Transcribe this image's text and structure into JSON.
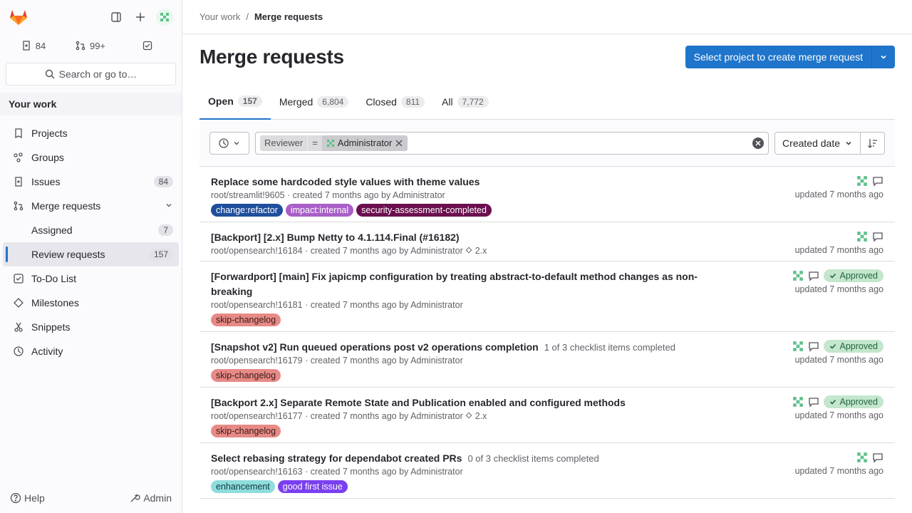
{
  "sidebar": {
    "counts": {
      "issues": "84",
      "merge_requests": "99+"
    },
    "search_label": "Search or go to…",
    "section_title": "Your work",
    "items": [
      {
        "label": "Projects"
      },
      {
        "label": "Groups"
      },
      {
        "label": "Issues",
        "badge": "84"
      },
      {
        "label": "Merge requests"
      },
      {
        "label": "Assigned",
        "badge": "7"
      },
      {
        "label": "Review requests",
        "badge": "157"
      },
      {
        "label": "To-Do List"
      },
      {
        "label": "Milestones"
      },
      {
        "label": "Snippets"
      },
      {
        "label": "Activity"
      }
    ],
    "help_label": "Help",
    "admin_label": "Admin"
  },
  "breadcrumb": {
    "parent": "Your work",
    "current": "Merge requests"
  },
  "page": {
    "title": "Merge requests",
    "cta_label": "Select project to create merge request"
  },
  "tabs": [
    {
      "label": "Open",
      "count": "157"
    },
    {
      "label": "Merged",
      "count": "6,804"
    },
    {
      "label": "Closed",
      "count": "811"
    },
    {
      "label": "All",
      "count": "7,772"
    }
  ],
  "filter": {
    "token_field": "Reviewer",
    "token_op": "=",
    "token_value": "Administrator",
    "sort_label": "Created date"
  },
  "merge_requests": [
    {
      "title": "Replace some hardcoded style values with theme values",
      "meta_ref": "root/streamlit!9605",
      "meta_created": "· created 7 months ago by",
      "author": "Administrator",
      "updated": "updated 7 months ago",
      "labels": [
        {
          "text": "change:refactor",
          "color": "#1f4e9c"
        },
        {
          "text": "impact:internal",
          "color": "#a95fc7"
        },
        {
          "text": "security-assessment-completed",
          "color": "#6b0f4e"
        }
      ]
    },
    {
      "title": "[Backport] [2.x] Bump Netty to 4.1.114.Final (#16182)",
      "meta_ref": "root/opensearch!16184",
      "meta_created": "· created 7 months ago by",
      "author": "Administrator",
      "milestone": "2.x",
      "updated": "updated 7 months ago"
    },
    {
      "title": "[Forwardport] [main] Fix japicmp configuration by treating abstract-to-default method changes as non-breaking",
      "meta_ref": "root/opensearch!16181",
      "meta_created": "· created 7 months ago by",
      "author": "Administrator",
      "approved_label": "Approved",
      "updated": "updated 7 months ago",
      "labels": [
        {
          "text": "skip-changelog",
          "color": "#e78a86"
        }
      ]
    },
    {
      "title": "[Snapshot v2] Run queued operations post v2 operations completion",
      "checklist": "1 of 3 checklist items completed",
      "meta_ref": "root/opensearch!16179",
      "meta_created": "· created 7 months ago by",
      "author": "Administrator",
      "approved_label": "Approved",
      "updated": "updated 7 months ago",
      "labels": [
        {
          "text": "skip-changelog",
          "color": "#e78a86"
        }
      ]
    },
    {
      "title": "[Backport 2.x] Separate Remote State and Publication enabled and configured methods",
      "meta_ref": "root/opensearch!16177",
      "meta_created": "· created 7 months ago by",
      "author": "Administrator",
      "milestone": "2.x",
      "approved_label": "Approved",
      "updated": "updated 7 months ago",
      "labels": [
        {
          "text": "skip-changelog",
          "color": "#e78a86"
        }
      ]
    },
    {
      "title": "Select rebasing strategy for dependabot created PRs",
      "checklist": "0 of 3 checklist items completed",
      "meta_ref": "root/opensearch!16163",
      "meta_created": "· created 7 months ago by",
      "author": "Administrator",
      "updated": "updated 7 months ago",
      "labels": [
        {
          "text": "enhancement",
          "color": "#8fdcde"
        },
        {
          "text": "good first issue",
          "color": "#7a3ff0"
        }
      ]
    }
  ],
  "colors": {
    "accent": "#1f75cb",
    "approved_bg": "#c3e6cd"
  }
}
